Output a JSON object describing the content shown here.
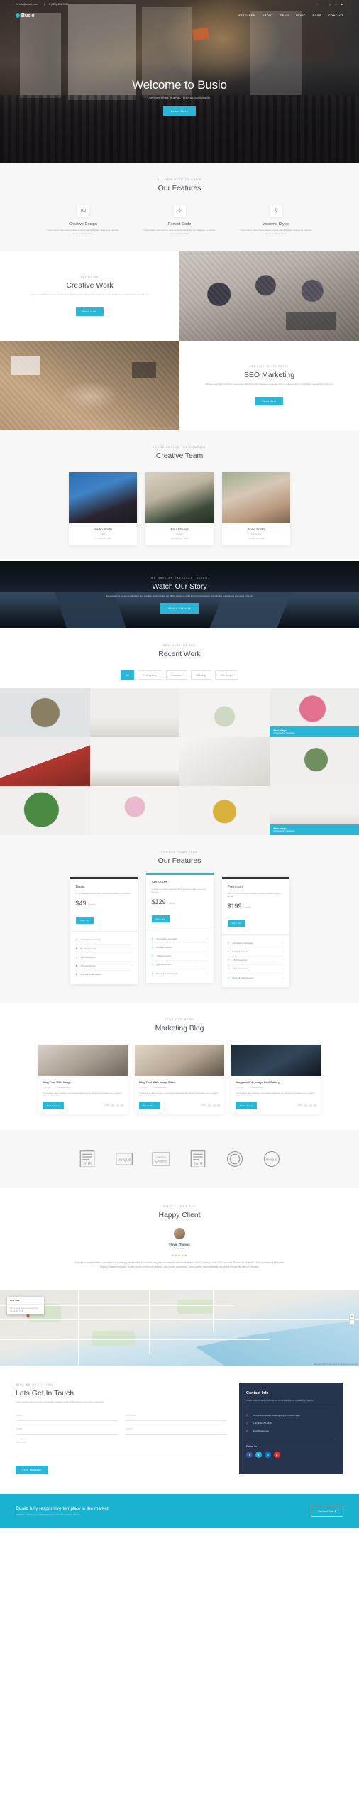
{
  "topbar": {
    "email": "info@busio.com",
    "phone": "+1 (123) 456-7890",
    "email_icon": "envelope-icon",
    "phone_icon": "phone-icon",
    "socials": [
      "facebook",
      "twitter",
      "google-plus",
      "linkedin",
      "youtube"
    ]
  },
  "nav": {
    "brand": "Busio",
    "links": [
      {
        "label": "FEATURES",
        "active": false
      },
      {
        "label": "ABOUT",
        "active": false
      },
      {
        "label": "TEAM",
        "active": false
      },
      {
        "label": "WORK",
        "active": false
      },
      {
        "label": "BLOG",
        "active": false
      },
      {
        "label": "CONTACT",
        "active": false
      }
    ]
  },
  "hero": {
    "title": "Welcome to Busio",
    "subtitle": "Aenean tellus vitae ac rhoncus Sollicitudin",
    "cta": "Learn More"
  },
  "features": {
    "eyebrow": "ALL YOU NEED TO KNOW",
    "title": "Our Features",
    "items": [
      {
        "icon": "image-icon",
        "title": "Creative Design",
        "text": "Consectetur lorem ipsum dolor sit amet adipiscing elit. Aliquam a molestie enim, a massa nunc."
      },
      {
        "icon": "gear-icon",
        "title": "Perfect Code",
        "text": "Consectetur lorem ipsum dolor sit amet adipiscing elit. Aliquam a molestie enim, a massa nunc."
      },
      {
        "icon": "trophy-icon",
        "title": "wesome Styles",
        "text": "Consectetur lorem ipsum dolor sit amet adipiscing elit. Aliquam a molestie enim, a massa nunc."
      }
    ]
  },
  "about": {
    "eyebrow": "ABOUT US",
    "title": "Creative Work",
    "text": "Aliquam erat dolor sit amet, consectetur adipiscing elit. Aliquam a molestie enim, a massa nunc eleifend nunc quis felis est.",
    "cta": "Read More"
  },
  "seo": {
    "eyebrow": "SERVICE WE PROVIDE",
    "title": "SEO Marketing",
    "text": "Aliquam erat dolor sit amet, consectetur adipiscing elit. Aliquam a molestie enim, a massa nunc. In id eleifend mauris Nunc felis est.",
    "cta": "Read More"
  },
  "team": {
    "eyebrow": "HEROS BEHIND THE COMPANY",
    "title": "Creative Team",
    "members": [
      {
        "name": "Martin Smith",
        "role": "CEO",
        "phone": "+1 (123) 456 7889"
      },
      {
        "name": "Paul Flavius",
        "role": "Design",
        "phone": "+1 (123) 456 7889"
      },
      {
        "name": "Anne Smith",
        "role": "Community",
        "phone": "+1 (123) 456 7889"
      }
    ]
  },
  "video": {
    "eyebrow": "WE HAVE AN EXCELLENT VIDEO",
    "title": "Watch Our Story",
    "text": "Excepteur sint occaecat cupidatat non proident, sunt in culpa qui officia deserunt mollit anim id est laborum. Perspiciatis unde omnis iste natus error sit.",
    "cta": "Watch Video"
  },
  "work": {
    "eyebrow": "SEE WHAT WE DID",
    "title": "Recent Work",
    "filters": [
      {
        "label": "All",
        "active": true
      },
      {
        "label": "Photography",
        "active": false
      },
      {
        "label": "Illustration",
        "active": false
      },
      {
        "label": "Branding",
        "active": false
      },
      {
        "label": "Web Design",
        "active": false
      }
    ],
    "items": [
      {
        "kind": "yarn-ball",
        "caption": null
      },
      {
        "kind": "chairs",
        "caption": null
      },
      {
        "kind": "plant-pot",
        "caption": null
      },
      {
        "kind": "pink-flower",
        "caption": {
          "title": "Past Image",
          "sub": "Photography - Illustration"
        }
      },
      {
        "kind": "car",
        "caption": null
      },
      {
        "kind": "interior",
        "caption": null
      },
      {
        "kind": "stationery",
        "caption": null
      },
      {
        "kind": "vase-plant",
        "caption": null
      },
      {
        "kind": "green-leaf",
        "caption": null
      },
      {
        "kind": "flower-vases",
        "caption": null
      },
      {
        "kind": "fruit-bowl",
        "caption": null
      },
      {
        "kind": "white-pots",
        "caption": {
          "title": "Past Image",
          "sub": "Photography - Illustration"
        }
      }
    ]
  },
  "pricing": {
    "eyebrow": "CHOOSE YOUR PLAN",
    "title": "Our Features",
    "plans": [
      {
        "name": "Basic",
        "desc": "In this package dolor sit amet occaecat cupidatat non proident.",
        "price": "$49",
        "period": "/ month",
        "cta": "Sign Up",
        "featured": false,
        "features": [
          {
            "label": "20 Analytics Campaign",
            "included": true
          },
          {
            "label": "Branded Reports",
            "included": false
          },
          {
            "label": "1,500 Keywords",
            "included": true
          },
          {
            "label": "4 Social Account",
            "included": false
          },
          {
            "label": "Phone & Email Support",
            "included": false
          }
        ]
      },
      {
        "name": "Standard",
        "desc": "Suitable for medium sit amet officia deserunt mollit anim id est laborum.",
        "price": "$129",
        "period": "/ month",
        "cta": "Sign Up",
        "featured": true,
        "features": [
          {
            "label": "20 Analytics Campaign",
            "included": true
          },
          {
            "label": "Branded Reports",
            "included": true
          },
          {
            "label": "1,500 Keywords",
            "included": true
          },
          {
            "label": "4 Social Account",
            "included": true
          },
          {
            "label": "Phone & Email Support",
            "included": true
          }
        ]
      },
      {
        "name": "Premium",
        "desc": "Best for sit amet tempor incididunt ut labore et dolore magna aliqua.",
        "price": "$199",
        "period": "/ month",
        "cta": "Sign Up",
        "featured": false,
        "features": [
          {
            "label": "20 Analytics Campaign",
            "included": true
          },
          {
            "label": "Branded Reports",
            "included": true
          },
          {
            "label": "1,500 Keywords",
            "included": true
          },
          {
            "label": "4 Social Account",
            "included": true
          },
          {
            "label": "Phone & Email Support",
            "included": true
          }
        ]
      }
    ]
  },
  "blog": {
    "eyebrow": "READ OUR NEWS",
    "title": "Marketing Blog",
    "posts": [
      {
        "title": "Blog Post With Image",
        "date": "21 Sep",
        "category": "Uncategorized",
        "text": "Lorem ipsum dolor sit amet, consectetur adipiscing elit. Aliquam a molestie enim, a massa nunc condimentum.",
        "cta": "Read More",
        "share": "Share"
      },
      {
        "title": "Blog Post With Image Slider",
        "date": "21 Sep",
        "category": "Uncategorized",
        "text": "Lorem ipsum dolor sit amet, consectetur adipiscing elit. Aliquam a molestie enim, a massa nunc condimentum.",
        "cta": "Read More",
        "share": "Share"
      },
      {
        "title": "Blogpost With Image Grid Gallery",
        "date": "21 Sep",
        "category": "Uncategorized",
        "text": "Lorem ipsum dolor sit amet, consectetur adipiscing elit. Aliquam a molestie enim, a massa nunc condimentum.",
        "cta": "Read More",
        "share": "Share"
      }
    ]
  },
  "clients": {
    "badges": [
      {
        "name": "award-badge-2015",
        "label": "2015"
      },
      {
        "name": "unique-badge",
        "label": "UNIQUE"
      },
      {
        "name": "graphic-badge",
        "label": "Graphic"
      },
      {
        "name": "award-badge-2015-b",
        "label": "2015"
      },
      {
        "name": "circle-badge",
        "label": ""
      },
      {
        "name": "unique-circle-badge",
        "label": "UNIQUE"
      }
    ]
  },
  "testimonial": {
    "eyebrow": "WHAT CLIENT SAY",
    "title": "Happy Client",
    "name": "Flavin Thomas",
    "role": "Art Director",
    "stars": "★★★★★",
    "text": "Contrary to popular belief, Lorem Ipsum is not simply random text. It has roots in a piece of classical Latin literature from 45 BC, making it over 2000 years old. Richard McClintock, a Latin professor at Hampden-Sydney College in Virginia, looked up one of the more obscure Latin words, consectetur, from a Lorem Ipsum passage, and going through the cites of the word."
  },
  "map": {
    "card_title": "New York",
    "card_text": "123, Lorem Ipsum, Dummy City, FL-12345 USA",
    "attribution": "Map data ©2017 Google   Terms of Use   Report a map error",
    "zoom_in": "+",
    "zoom_out": "−"
  },
  "contact": {
    "eyebrow": "WILL WE GET IT YOU",
    "title": "Lets Get In Touch",
    "subtitle": "Lorem ipsum dolor sit amet, consectetur adipiscing elit. Pellentesque eros quam cras amet.",
    "fields": {
      "name": "Name*",
      "last_name": "Last Name",
      "email": "Email*",
      "phone": "Phone*",
      "comment": "Comment*"
    },
    "submit": "Send Message",
    "info": {
      "title": "Contact Info",
      "text": "Lorem ipsum is simply dummy text of the printing and typesetting industry.",
      "address": "123, Lorem Ipsum, Dummy City, FL-12345 USA",
      "phone": "+(1) 123-878-1645",
      "email": "info@busio.com",
      "follow_label": "Follow Us",
      "address_icon": "map-pin-icon",
      "phone_icon": "mobile-icon",
      "email_icon": "envelope-icon",
      "socials": [
        {
          "name": "facebook",
          "glyph": "f",
          "color": "#3b5998"
        },
        {
          "name": "twitter",
          "glyph": "t",
          "color": "#29a9e0"
        },
        {
          "name": "linkedin",
          "glyph": "in",
          "color": "#0077b5"
        },
        {
          "name": "youtube",
          "glyph": "▶",
          "color": "#e02f2f"
        }
      ]
    }
  },
  "footer": {
    "brand": "Busio",
    "tagline": "fully responsive template in the market",
    "subtext": "Exclusive multi purpose lightweight responsive with powerful features.",
    "cta": "Purchase Now",
    "cta_icon": "download-icon",
    "accent": "#19b2cf"
  }
}
